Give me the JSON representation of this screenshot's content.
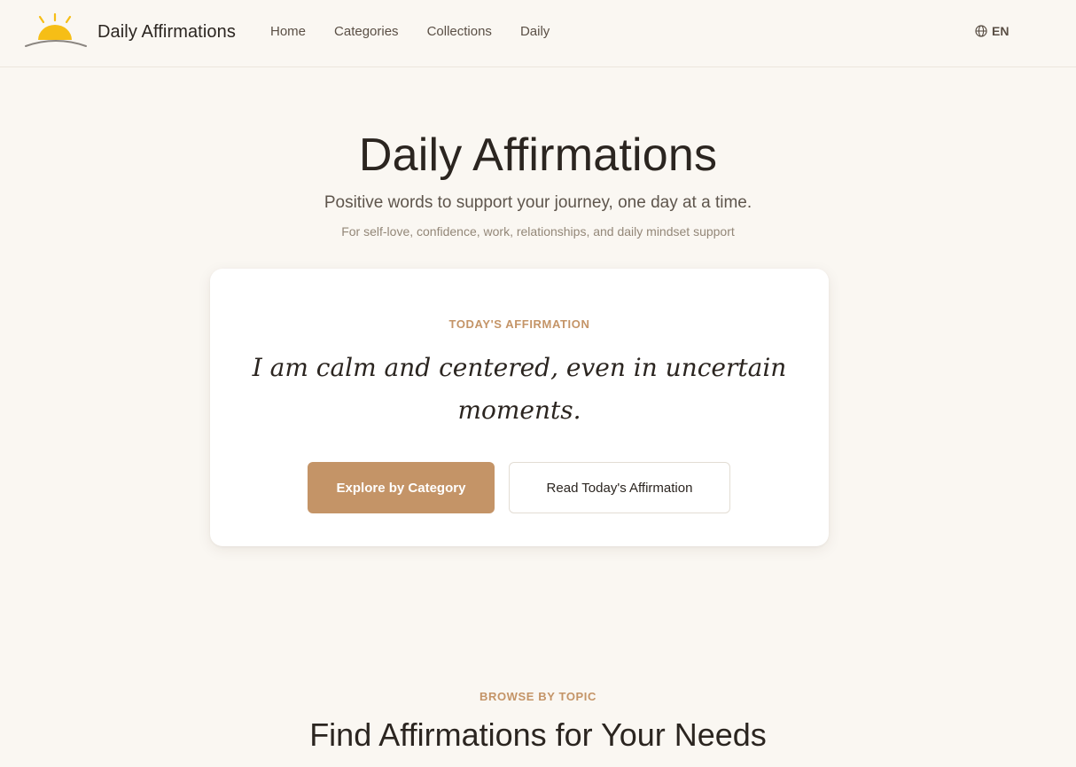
{
  "header": {
    "brand_name": "Daily Affirmations",
    "nav": [
      {
        "label": "Home"
      },
      {
        "label": "Categories"
      },
      {
        "label": "Collections"
      },
      {
        "label": "Daily"
      }
    ],
    "language": "EN",
    "icons": {
      "logo": "sunrise-logo",
      "language": "globe-icon"
    }
  },
  "hero": {
    "title": "Daily Affirmations",
    "subtitle": "Positive words to support your journey, one day at a time.",
    "tagline": "For self-love, confidence, work, relationships, and daily mindset support"
  },
  "card": {
    "label": "TODAY'S AFFIRMATION",
    "quote": "I am calm and centered, even in uncertain moments.",
    "primary_button": "Explore by Category",
    "secondary_button": "Read Today's Affirmation"
  },
  "browse": {
    "label": "BROWSE BY TOPIC",
    "title": "Find Affirmations for Your Needs"
  },
  "colors": {
    "background": "#faf7f2",
    "accent": "#c49467",
    "text": "#2b2520",
    "sun": "#f6be16"
  }
}
